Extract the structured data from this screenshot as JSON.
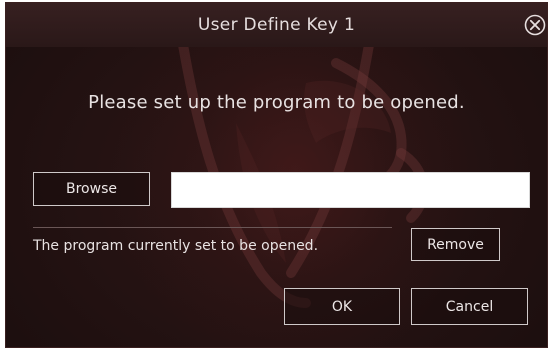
{
  "window": {
    "title": "User Define Key  1"
  },
  "icons": {
    "close": "close-icon",
    "background": "dragon-emblem-icon"
  },
  "prompt": "Please set up the program to be opened.",
  "browse_label": "Browse",
  "path_input": {
    "value": "",
    "placeholder": ""
  },
  "status_text": "The program currently set to be opened.",
  "remove_label": "Remove",
  "ok_label": "OK",
  "cancel_label": "Cancel",
  "colors": {
    "panel_background": "#241212",
    "text": "#e8e2e2",
    "button_border": "#cfc9c9"
  }
}
